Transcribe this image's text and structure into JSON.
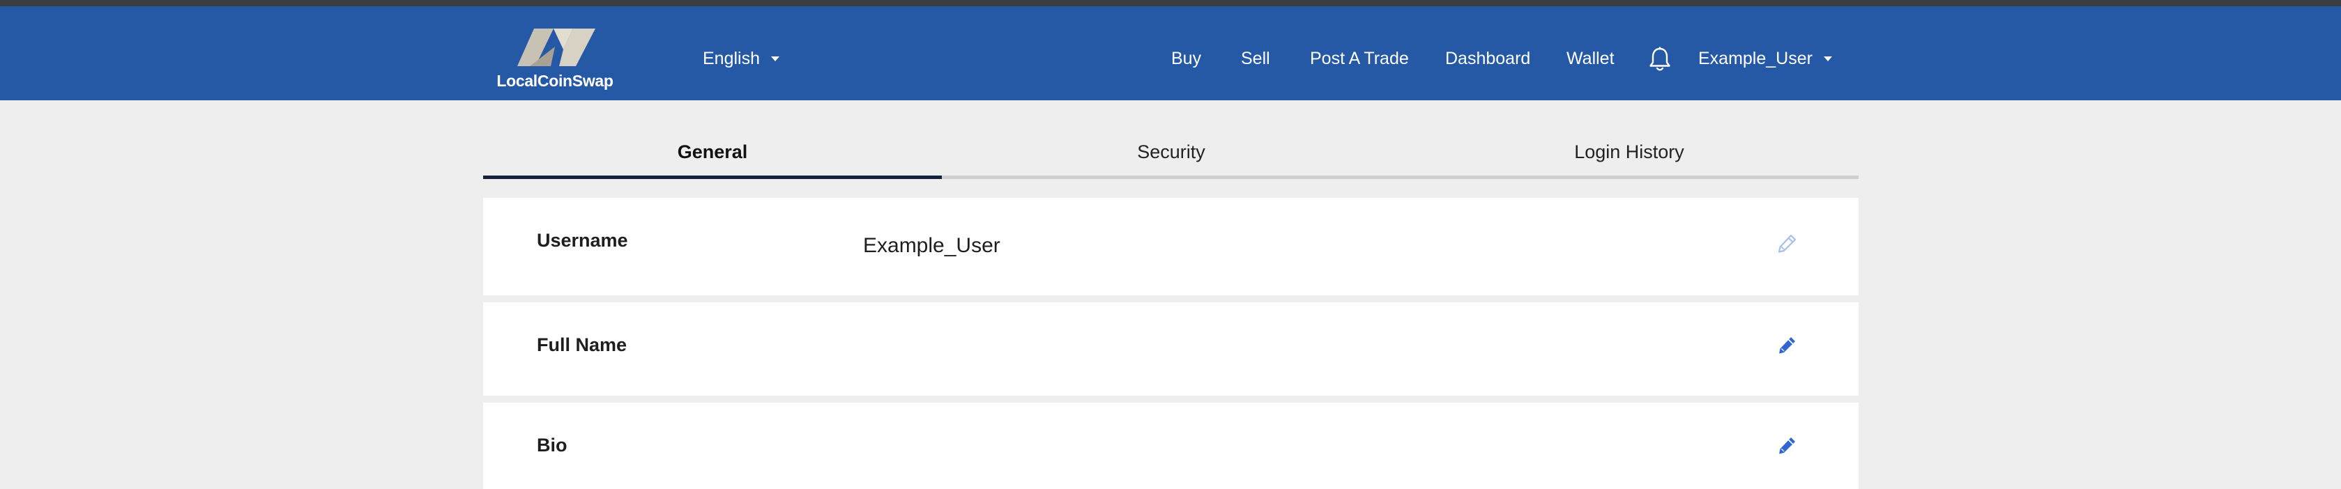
{
  "brand": {
    "name": "LocalCoinSwap"
  },
  "header": {
    "language": "English",
    "nav": {
      "buy": "Buy",
      "sell": "Sell",
      "post_trade": "Post A Trade",
      "dashboard": "Dashboard",
      "wallet": "Wallet"
    },
    "notifications_icon": "bell-icon",
    "user_menu": "Example_User"
  },
  "tabs": [
    {
      "label": "General",
      "active": true
    },
    {
      "label": "Security",
      "active": false
    },
    {
      "label": "Login History",
      "active": false
    }
  ],
  "fields": [
    {
      "label": "Username",
      "value": "Example_User",
      "editable": false
    },
    {
      "label": "Full Name",
      "value": "",
      "editable": true
    },
    {
      "label": "Bio",
      "value": "",
      "editable": true
    }
  ],
  "colors": {
    "header_bg": "#2559a6",
    "page_bg": "#eeeeee",
    "edit_icon": "#2f66d3",
    "edit_icon_disabled": "#a9c0ea",
    "active_tab_underline": "#15203a"
  }
}
